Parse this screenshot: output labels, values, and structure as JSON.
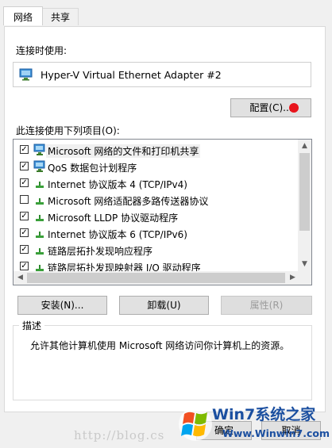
{
  "tabs": [
    {
      "label": "网络"
    },
    {
      "label": "共享"
    }
  ],
  "connect_using_label": "连接时使用:",
  "adapter_name": "Hyper-V Virtual Ethernet Adapter #2",
  "configure_button": "配置(C)...",
  "items_label": "此连接使用下列项目(O):",
  "items": [
    {
      "label": "Microsoft 网络的文件和打印机共享",
      "checked": true,
      "icon": "network-computer-icon"
    },
    {
      "label": "QoS 数据包计划程序",
      "checked": true,
      "icon": "network-computer-icon"
    },
    {
      "label": "Internet 协议版本 4 (TCP/IPv4)",
      "checked": true,
      "icon": "protocol-icon"
    },
    {
      "label": "Microsoft 网络适配器多路传送器协议",
      "checked": false,
      "icon": "protocol-icon"
    },
    {
      "label": "Microsoft LLDP 协议驱动程序",
      "checked": true,
      "icon": "protocol-icon"
    },
    {
      "label": "Internet 协议版本 6 (TCP/IPv6)",
      "checked": true,
      "icon": "protocol-icon"
    },
    {
      "label": "链路层拓扑发现响应程序",
      "checked": true,
      "icon": "protocol-icon"
    },
    {
      "label": "链路层拓扑发现映射器 I/O 驱动程序",
      "checked": true,
      "icon": "protocol-icon"
    }
  ],
  "buttons": {
    "install": "安装(N)...",
    "uninstall": "卸载(U)",
    "properties": "属性(R)"
  },
  "description_title": "描述",
  "description_text": "允许其他计算机使用 Microsoft 网络访问你计算机上的资源。",
  "bottom_buttons": {
    "ok": "确定",
    "cancel": "取消"
  },
  "watermark": "http://blog.cs",
  "logo": {
    "line1": "Win7系统之家",
    "line2": "Www.Winwin7.com"
  },
  "colors": {
    "accent_dot": "#e8141c",
    "logo_blue": "#1b4fa0"
  }
}
